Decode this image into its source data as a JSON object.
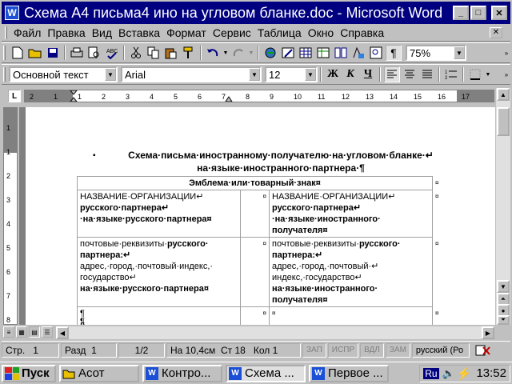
{
  "window": {
    "title": "Схема А4 письма4 ино на угловом бланке.doc - Microsoft Word",
    "app_icon": "W"
  },
  "menu": [
    "Файл",
    "Правка",
    "Вид",
    "Вставка",
    "Формат",
    "Сервис",
    "Таблица",
    "Окно",
    "Справка"
  ],
  "toolbar": {
    "zoom": "75%"
  },
  "format_bar": {
    "style": "Основной текст",
    "font": "Arial",
    "size": "12",
    "bold": "Ж",
    "italic": "К",
    "underline": "Ч"
  },
  "ruler": {
    "corner": "L",
    "h_ticks": [
      "2",
      "1",
      "1",
      "2",
      "3",
      "4",
      "5",
      "6",
      "7",
      "8",
      "9",
      "10",
      "11",
      "12",
      "13",
      "14",
      "15",
      "16",
      "17"
    ],
    "v_ticks": [
      "1",
      "1",
      "2",
      "3",
      "4",
      "5",
      "6",
      "7",
      "8"
    ]
  },
  "document": {
    "bullet": "▪",
    "heading_line1": "Схема·письма·иностранному·получателю·на·угловом·бланке·↵",
    "heading_line2": "на·языке·иностранного·партнера·¶",
    "emblem": "Эмблема·или·товарный·знак¤",
    "cell_mark": "¤",
    "row_mark": "¤",
    "left_col": {
      "org_line1": "НАЗВАНИЕ·ОРГАНИЗАЦИИ↵",
      "org_line2": "русского·партнера↵",
      "org_line3": "·на·языке·русского·партнера¤",
      "addr_line1a": "почтовые·реквизиты·",
      "addr_line1b": "русского·",
      "addr_line2": "партнера:↵",
      "addr_line3": "адрес,·город,·почтовый·индекс,·",
      "addr_line4": "государство↵",
      "addr_line5": "на·языке·русского·партнера¤"
    },
    "right_col": {
      "org_line1": "НАЗВАНИЕ·ОРГАНИЗАЦИИ↵",
      "org_line2": "русского·партнера↵",
      "org_line3": "·на·языке·иностранного·",
      "org_line4": "получателя¤",
      "addr_line1a": "почтовые·реквизиты·",
      "addr_line1b": "русского·",
      "addr_line2": "партнера:↵",
      "addr_line3": "адрес,·город,·почтовый·↵",
      "addr_line4": "индекс,·государство↵",
      "addr_line5": "на·языке·иностранного·",
      "addr_line6": "получателя¤"
    },
    "last_row_para": "¶",
    "last_row_cell": "¤",
    "after_table_para": "¶"
  },
  "status": {
    "page": "Стр.",
    "page_num": "1",
    "section": "Разд",
    "section_num": "1",
    "pages": "1/2",
    "pos": "На 10,4см",
    "line": "Ст",
    "line_num": "18",
    "col": "Кол",
    "col_num": "1",
    "rec": "ЗАП",
    "trk": "ИСПР",
    "ext": "ВДЛ",
    "ovr": "ЗАМ",
    "lang": "русский (Ро"
  },
  "taskbar": {
    "start": "Пуск",
    "tasks": [
      "Асот",
      "Контро...",
      "Схема ...",
      "Первое ..."
    ],
    "lang": "Ru",
    "clock": "13:52"
  }
}
